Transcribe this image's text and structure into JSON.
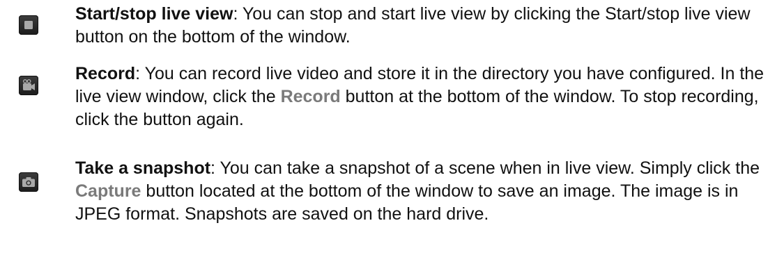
{
  "entries": [
    {
      "icon": "stop-icon",
      "title": "Start/stop live view",
      "parts": [
        ": You can stop and start live view by clicking the Start/stop live view button on the bottom of the window."
      ]
    },
    {
      "icon": "video-camera-icon",
      "title": "Record",
      "pre": ": You can record live video and store it in the directory you have configured. In the live view window, click the ",
      "link": "Record",
      "post": " button at the bottom of the window. To stop recording, click the button again."
    },
    {
      "icon": "camera-icon",
      "title": "Take a snapshot",
      "pre": ": You can take a snapshot of a scene when in live view. Simply click the ",
      "link": "Capture",
      "post": " button located at the bottom of the window to save an image. The image is in JPEG format. Snapshots are saved on the hard drive."
    }
  ],
  "colors": {
    "text": "#111111",
    "accent": "#7a7a7a",
    "icon_bg": "#2b2b2b",
    "icon_fg": "#a9a9a9"
  }
}
